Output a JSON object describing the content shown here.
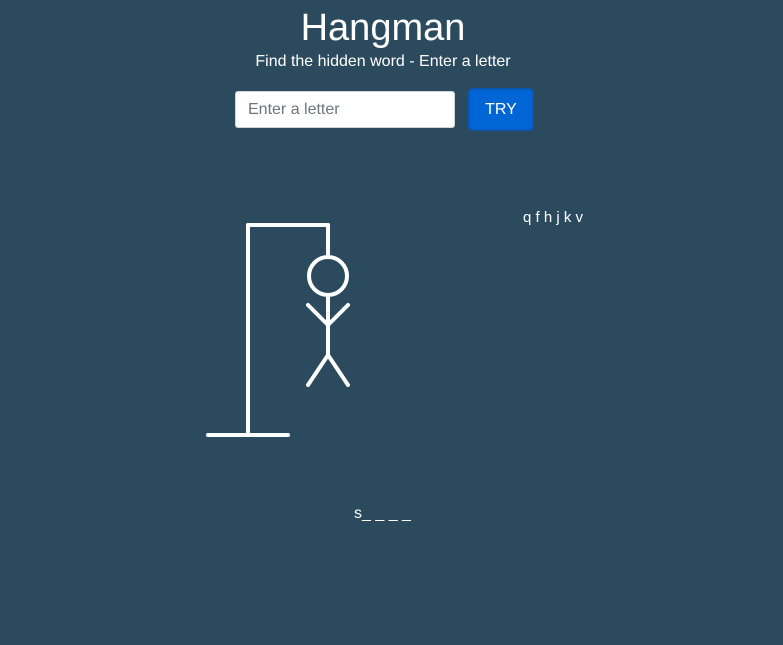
{
  "header": {
    "title": "Hangman",
    "subtitle": "Find the hidden word - Enter a letter"
  },
  "input": {
    "placeholder": "Enter a letter",
    "value": ""
  },
  "try_button": {
    "label": "TRY"
  },
  "game": {
    "wrong_letters": "q f h j k v",
    "word_display": "s_ _ _ _",
    "wrong_guess_count": 6,
    "figure_parts_shown": [
      "head",
      "body",
      "left-arm",
      "right-arm",
      "left-leg",
      "right-leg"
    ]
  },
  "colors": {
    "background": "#2c4a5e",
    "text": "#ffffff",
    "button": "#0066d6",
    "drawing": "#ffffff"
  }
}
